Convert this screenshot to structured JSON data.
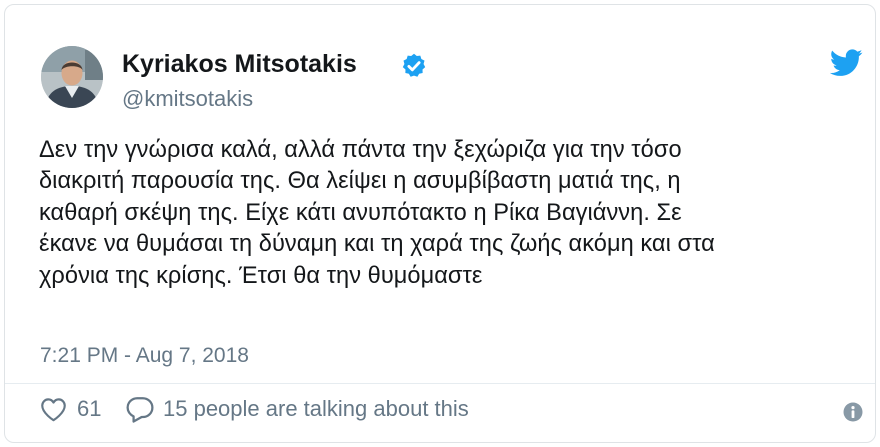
{
  "author": {
    "name": "Kyriakos Mitsotakis",
    "handle": "@kmitsotakis",
    "verified": true
  },
  "tweet": {
    "lines": [
      "Δεν την γνώρισα καλά, αλλά πάντα την ξεχώριζα για την τόσο",
      "διακριτή παρουσία της. Θα λείψει η ασυμβίβαστη ματιά της, η",
      "καθαρή σκέψη της. Είχε κάτι ανυπότακτο η Ρίκα Βαγιάννη. Σε",
      "έκανε να θυμάσαι τη δύναμη και τη χαρά της ζωής ακόμη και στα",
      "χρόνια της κρίσης. Έτσι θα την θυμόμαστε"
    ],
    "timestamp": "7:21 PM - Aug 7, 2018"
  },
  "actions": {
    "like_count": "61",
    "talking": "15 people are talking about this"
  },
  "colors": {
    "twitter_blue": "#1da1f2",
    "muted_text": "#657786",
    "primary_text": "#14171a"
  },
  "icons": [
    "twitter-bird-icon",
    "verified-badge-icon",
    "heart-icon",
    "reply-bubble-icon",
    "info-icon"
  ]
}
